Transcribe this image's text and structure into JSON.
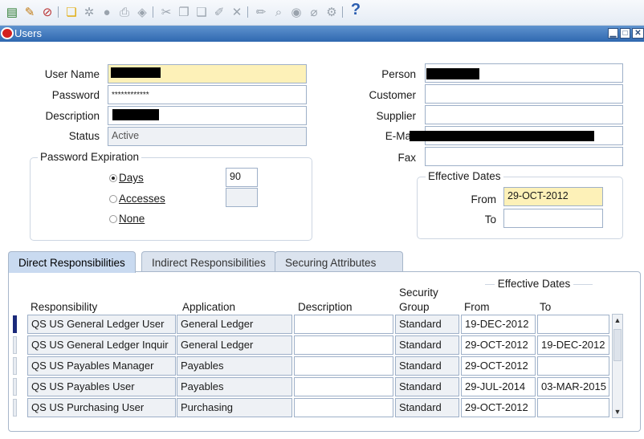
{
  "window": {
    "title": "Users"
  },
  "toolbar": {
    "icons": [
      "new-record-icon",
      "search-icon",
      "navigate-icon",
      "open-folder-icon",
      "save-icon",
      "next-step-icon",
      "print-icon",
      "close-form-icon",
      "cut-icon",
      "copy-icon",
      "paste-icon",
      "clear-record-icon",
      "delete-record-icon",
      "edit-icon",
      "zoom-icon",
      "translations-icon",
      "attachments-icon",
      "folder-tools-icon",
      "help-icon"
    ],
    "help_label": "?"
  },
  "user": {
    "labels": {
      "user_name": "User Name",
      "password": "Password",
      "description": "Description",
      "status": "Status"
    },
    "password_value": "************",
    "status_value": "Active"
  },
  "person": {
    "labels": {
      "person": "Person",
      "customer": "Customer",
      "supplier": "Supplier",
      "email": "E-Mail",
      "fax": "Fax"
    }
  },
  "password_expiration": {
    "title": "Password Expiration",
    "days": {
      "label": "Days",
      "value": "90",
      "selected": true
    },
    "accesses": {
      "label": "Accesses"
    },
    "none": {
      "label": "None"
    }
  },
  "effective_dates": {
    "title": "Effective Dates",
    "from_label": "From",
    "to_label": "To",
    "from_value": "29-OCT-2012",
    "to_value": ""
  },
  "tabs": [
    {
      "label": "Direct Responsibilities",
      "active": true
    },
    {
      "label": "Indirect Responsibilities",
      "active": false
    },
    {
      "label": "Securing Attributes",
      "active": false
    }
  ],
  "responsibilities": {
    "headers": {
      "responsibility": "Responsibility",
      "application": "Application",
      "description": "Description",
      "security_group_line1": "Security",
      "security_group_line2": "Group",
      "effective_dates": "Effective Dates",
      "from": "From",
      "to": "To"
    },
    "rows": [
      {
        "responsibility": "QS US General Ledger User",
        "application": "General Ledger",
        "description": "",
        "security_group": "Standard",
        "from": "19-DEC-2012",
        "to": ""
      },
      {
        "responsibility": "QS US General Ledger Inquir",
        "application": "General Ledger",
        "description": "",
        "security_group": "Standard",
        "from": "29-OCT-2012",
        "to": "19-DEC-2012"
      },
      {
        "responsibility": "QS US Payables Manager",
        "application": "Payables",
        "description": "",
        "security_group": "Standard",
        "from": "29-OCT-2012",
        "to": ""
      },
      {
        "responsibility": "QS US Payables User",
        "application": "Payables",
        "description": "",
        "security_group": "Standard",
        "from": "29-JUL-2014",
        "to": "03-MAR-2015"
      },
      {
        "responsibility": "QS US Purchasing User",
        "application": "Purchasing",
        "description": "",
        "security_group": "Standard",
        "from": "29-OCT-2012",
        "to": ""
      }
    ]
  }
}
